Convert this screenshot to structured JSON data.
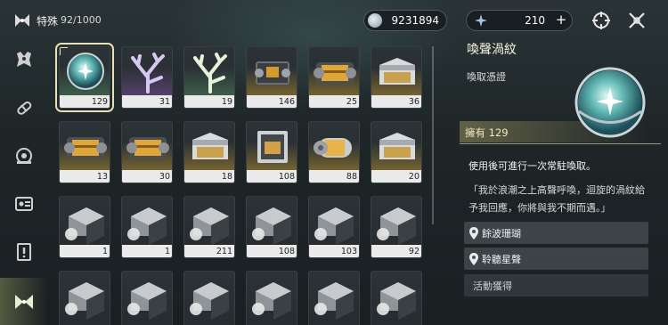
{
  "header": {
    "category_title": "特殊",
    "capacity": "92/1000",
    "currency1": {
      "amount": "9231894",
      "icon": "silver-coin-icon"
    },
    "currency2": {
      "amount": "210",
      "icon": "star-crystal-icon",
      "add_label": "+"
    }
  },
  "nav": {
    "items": [
      {
        "name": "nav-echo-icon"
      },
      {
        "name": "nav-capsule-icon"
      },
      {
        "name": "nav-device-icon"
      },
      {
        "name": "nav-resource-icon"
      },
      {
        "name": "nav-alert-icon"
      },
      {
        "name": "nav-special-icon",
        "active": true
      }
    ]
  },
  "inventory": {
    "items": [
      {
        "qty": "129",
        "art": "orb",
        "rarity": "green",
        "selected": true
      },
      {
        "qty": "31",
        "art": "coral-purple",
        "rarity": "purple"
      },
      {
        "qty": "19",
        "art": "coral-green",
        "rarity": "green"
      },
      {
        "qty": "146",
        "art": "chest-dark",
        "rarity": "gold"
      },
      {
        "qty": "25",
        "art": "chest-gold",
        "rarity": "gold"
      },
      {
        "qty": "36",
        "art": "chest-box",
        "rarity": "gold"
      },
      {
        "qty": "13",
        "art": "chest-gold",
        "rarity": "gold"
      },
      {
        "qty": "30",
        "art": "chest-gold",
        "rarity": "gold"
      },
      {
        "qty": "18",
        "art": "chest-box",
        "rarity": "gold"
      },
      {
        "qty": "108",
        "art": "chest-cage",
        "rarity": "gold"
      },
      {
        "qty": "88",
        "art": "canister",
        "rarity": "gold"
      },
      {
        "qty": "20",
        "art": "chest-box",
        "rarity": "gold"
      },
      {
        "qty": "1",
        "art": "echo-box",
        "rarity": "none"
      },
      {
        "qty": "1",
        "art": "echo-box",
        "rarity": "none"
      },
      {
        "qty": "211",
        "art": "echo-box",
        "rarity": "none"
      },
      {
        "qty": "108",
        "art": "echo-box",
        "rarity": "none"
      },
      {
        "qty": "103",
        "art": "echo-box",
        "rarity": "none"
      },
      {
        "qty": "92",
        "art": "echo-box",
        "rarity": "none"
      },
      {
        "qty": "",
        "art": "echo-box",
        "rarity": "none"
      },
      {
        "qty": "",
        "art": "echo-box",
        "rarity": "none"
      },
      {
        "qty": "",
        "art": "echo-box",
        "rarity": "none"
      },
      {
        "qty": "",
        "art": "echo-box",
        "rarity": "none"
      },
      {
        "qty": "",
        "art": "echo-box",
        "rarity": "none"
      },
      {
        "qty": "",
        "art": "echo-box",
        "rarity": "none"
      }
    ]
  },
  "detail": {
    "name": "喚聲渦紋",
    "subtitle": "喚取憑證",
    "owned": "擁有 129",
    "use_desc": "使用後可進行一次常駐喚取。",
    "flavor": "「我於浪潮之上高聲呼喚，迴旋的渦紋給予我回應，你將與我不期而遇。」",
    "sources": [
      {
        "label": "餘波珊瑚",
        "icon": "location-pin-icon"
      },
      {
        "label": "聆聽星聲",
        "icon": "location-pin-icon"
      },
      {
        "label": "活動獲得"
      }
    ]
  },
  "colors": {
    "accent_gold": "#e9dfb8",
    "qty_bar": "#eaeaea"
  }
}
